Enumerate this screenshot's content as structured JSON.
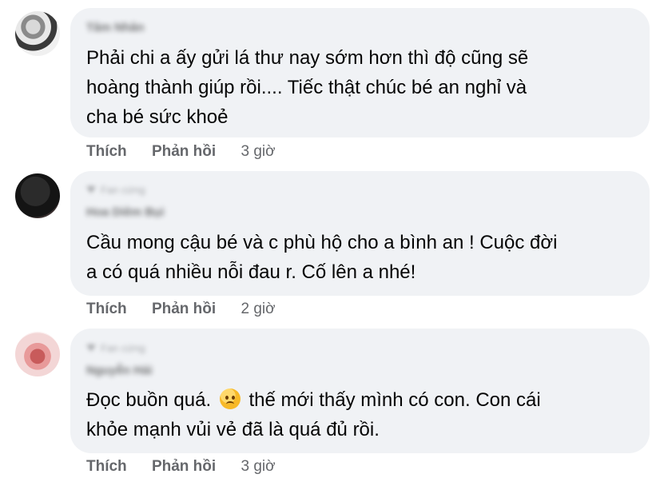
{
  "comments": [
    {
      "author_name": "Tâm Nhân",
      "badge": "",
      "text_lines": [
        "Phải chi a ấy gửi lá thư nay sớm hơn thì độ cũng sẽ",
        "hoàng thành giúp rồi.... Tiếc thật chúc bé an nghỉ và",
        "cha bé sức khoẻ"
      ],
      "like_label": "Thích",
      "reply_label": "Phản hồi",
      "time": "3 giờ"
    },
    {
      "author_name": "Hoa Diêm Bụi",
      "badge": "Fan cứng",
      "text_lines": [
        "Cầu mong cậu bé và c phù hộ cho a bình an ! Cuộc đời",
        "a có quá nhiều nỗi đau r. Cố lên a nhé!"
      ],
      "like_label": "Thích",
      "reply_label": "Phản hồi",
      "time": "2 giờ"
    },
    {
      "author_name": "Nguyễn Hải",
      "badge": "Fan cứng",
      "text_line_1_before": "Đọc buồn quá.",
      "emoji": "sad-face-emoji",
      "text_line_1_after": "thế mới thấy mình có con. Con cái",
      "text_line_2": "khỏe mạnh vủi vẻ đã là quá đủ rồi.",
      "like_label": "Thích",
      "reply_label": "Phản hồi",
      "time": "3 giờ"
    }
  ],
  "colors": {
    "bubble": "#f0f2f5",
    "text": "#050505",
    "secondary": "#65676b"
  }
}
